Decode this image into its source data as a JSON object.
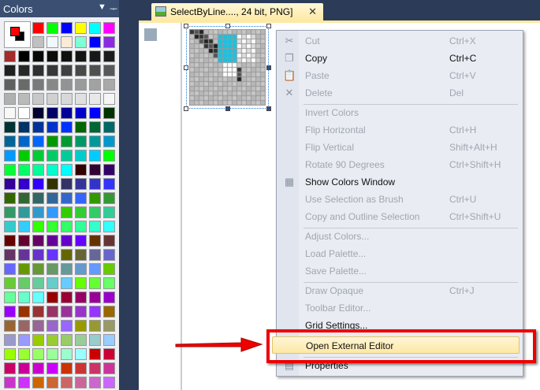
{
  "colors_panel": {
    "title": "Colors",
    "primary": "#ff0000",
    "secondary": "#000000",
    "top_rows": [
      [
        "#ff0000",
        "#00ff00",
        "#0000ff",
        "#ffff00",
        "#00ffff",
        "#ff00ff"
      ],
      [
        "#c0c0c0",
        "#f0f8ff",
        "#faebd7",
        "#7fffd4",
        "#0000ff",
        "#8a2be2"
      ]
    ],
    "rows": [
      [
        "#a52a2a",
        "#000000",
        "#080808",
        "#0c0c0c",
        "#101010",
        "#141414",
        "#181818",
        "#1c1c1c"
      ],
      [
        "#202020",
        "#282828",
        "#303030",
        "#383838",
        "#404040",
        "#484848",
        "#505050",
        "#585858"
      ],
      [
        "#606060",
        "#6a6a6a",
        "#7a7a7a",
        "#888888",
        "#939393",
        "#9a9a9a",
        "#a2a2a2",
        "#a9a9a9"
      ],
      [
        "#b0b0b0",
        "#bababa",
        "#c8c8c8",
        "#d0d0d0",
        "#d8d8d8",
        "#e0e0e0",
        "#e8e8e8",
        "#f5f5f5"
      ],
      [
        "#f8f8f8",
        "#ffffff",
        "#000033",
        "#000066",
        "#000099",
        "#0000cc",
        "#0000ff",
        "#003300"
      ],
      [
        "#003333",
        "#003366",
        "#003399",
        "#0033cc",
        "#0033ff",
        "#006600",
        "#006633",
        "#006666"
      ],
      [
        "#006699",
        "#0066cc",
        "#0066ff",
        "#009900",
        "#009933",
        "#009966",
        "#009999",
        "#0099cc"
      ],
      [
        "#0099ff",
        "#00cc00",
        "#00cc33",
        "#00cc66",
        "#00cc99",
        "#00cccc",
        "#00ccff",
        "#00ff00"
      ],
      [
        "#00ff33",
        "#00ff66",
        "#00ff99",
        "#00ffcc",
        "#00ffff",
        "#330000",
        "#330033",
        "#330066"
      ],
      [
        "#330099",
        "#3300cc",
        "#3300ff",
        "#333300",
        "#333366",
        "#333399",
        "#3333cc",
        "#3333ff"
      ],
      [
        "#336600",
        "#336633",
        "#336666",
        "#336699",
        "#3366cc",
        "#3366ff",
        "#339900",
        "#339933"
      ],
      [
        "#339966",
        "#339999",
        "#3399cc",
        "#3399ff",
        "#33cc00",
        "#33cc33",
        "#33cc66",
        "#33cc99"
      ],
      [
        "#33cccc",
        "#33ccff",
        "#33ff00",
        "#33ff33",
        "#33ff66",
        "#33ff99",
        "#33ffcc",
        "#33ffff"
      ],
      [
        "#660000",
        "#660033",
        "#660066",
        "#660099",
        "#6600cc",
        "#6600ff",
        "#663300",
        "#663333"
      ],
      [
        "#663366",
        "#663399",
        "#6633cc",
        "#6633ff",
        "#666600",
        "#666633",
        "#666699",
        "#6666cc"
      ],
      [
        "#6666ff",
        "#669900",
        "#669933",
        "#669966",
        "#669999",
        "#6699cc",
        "#6699ff",
        "#66cc00"
      ],
      [
        "#66cc33",
        "#66cc66",
        "#66cc99",
        "#66cccc",
        "#66ccff",
        "#66ff00",
        "#66ff33",
        "#66ff66"
      ],
      [
        "#66ff99",
        "#66ffcc",
        "#66ffff",
        "#990000",
        "#990033",
        "#990066",
        "#990099",
        "#9900cc"
      ],
      [
        "#9900ff",
        "#993300",
        "#993333",
        "#993366",
        "#993399",
        "#9933cc",
        "#9933ff",
        "#996600"
      ],
      [
        "#996633",
        "#996666",
        "#996699",
        "#9966cc",
        "#9966ff",
        "#999900",
        "#999933",
        "#999966"
      ],
      [
        "#9999cc",
        "#9999ff",
        "#99cc00",
        "#99cc33",
        "#99cc66",
        "#99cc99",
        "#99cccc",
        "#99ccff"
      ],
      [
        "#99ff00",
        "#99ff33",
        "#99ff66",
        "#99ff99",
        "#99ffcc",
        "#99ffff",
        "#cc0000",
        "#cc0033"
      ],
      [
        "#cc0066",
        "#cc0099",
        "#cc00cc",
        "#cc00ff",
        "#cc3300",
        "#cc3333",
        "#cc3366",
        "#cc3399"
      ],
      [
        "#cc33cc",
        "#cc33ff",
        "#cc6600",
        "#cc6633",
        "#cc6666",
        "#cc6699",
        "#cc66cc",
        "#cc66ff"
      ]
    ]
  },
  "tab": {
    "title": "SelectByLine...., 24 bit, PNG]"
  },
  "menu": {
    "items": [
      {
        "label": "Cut",
        "shortcut": "Ctrl+X",
        "enabled": false,
        "icon": "scissors-icon",
        "glyph": "✂"
      },
      {
        "label": "Copy",
        "shortcut": "Ctrl+C",
        "enabled": true,
        "icon": "copy-icon",
        "glyph": "❐"
      },
      {
        "label": "Paste",
        "shortcut": "Ctrl+V",
        "enabled": false,
        "icon": "paste-icon",
        "glyph": "📋"
      },
      {
        "label": "Delete",
        "shortcut": "Del",
        "enabled": false,
        "icon": "delete-icon",
        "glyph": "✕"
      },
      {
        "sep": true
      },
      {
        "label": "Invert Colors",
        "enabled": false
      },
      {
        "label": "Flip Horizontal",
        "shortcut": "Ctrl+H",
        "enabled": false
      },
      {
        "label": "Flip Vertical",
        "shortcut": "Shift+Alt+H",
        "enabled": false
      },
      {
        "label": "Rotate 90 Degrees",
        "shortcut": "Ctrl+Shift+H",
        "enabled": false
      },
      {
        "label": "Show Colors Window",
        "enabled": true,
        "icon": "colors-window-icon",
        "glyph": "▦"
      },
      {
        "label": "Use Selection as Brush",
        "shortcut": "Ctrl+U",
        "enabled": false
      },
      {
        "label": "Copy and Outline Selection",
        "shortcut": "Ctrl+Shift+U",
        "enabled": false
      },
      {
        "sep": true
      },
      {
        "label": "Adjust Colors...",
        "enabled": false
      },
      {
        "label": "Load Palette...",
        "enabled": false
      },
      {
        "label": "Save Palette...",
        "enabled": false
      },
      {
        "sep": true
      },
      {
        "label": "Draw Opaque",
        "shortcut": "Ctrl+J",
        "enabled": false
      },
      {
        "label": "Toolbar Editor...",
        "enabled": false
      },
      {
        "label": "Grid Settings...",
        "enabled": true
      },
      {
        "label": "Open External Editor",
        "enabled": true,
        "highlighted": true
      },
      {
        "sep": true
      },
      {
        "label": "Properties",
        "enabled": true,
        "icon": "properties-icon",
        "glyph": "▤"
      }
    ]
  },
  "accent": {
    "highlight_box": "#ee0000"
  }
}
